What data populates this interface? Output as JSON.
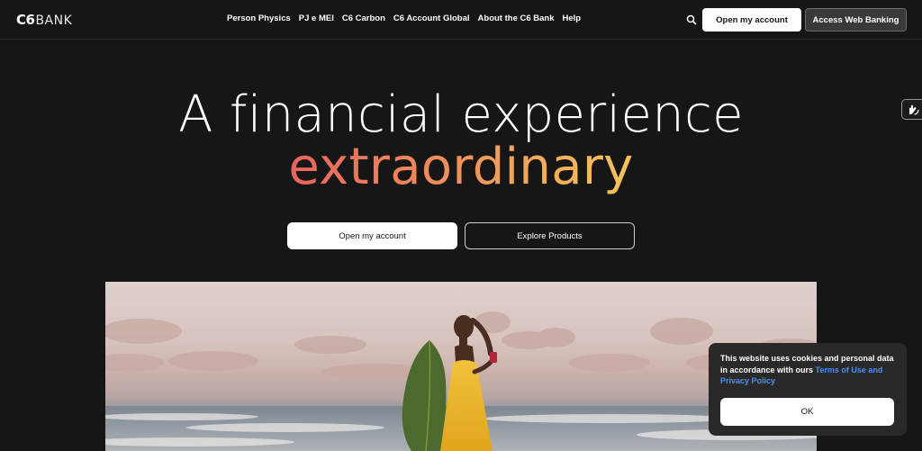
{
  "header": {
    "logo_main": "C6",
    "logo_sub": "BANK",
    "nav": [
      {
        "label": "Person Physics"
      },
      {
        "label": "PJ e MEI"
      },
      {
        "label": "C6 Carbon"
      },
      {
        "label": "C6 Account Global"
      },
      {
        "label": "About the C6 Bank"
      },
      {
        "label": "Help"
      }
    ],
    "search_icon": "search-icon",
    "open_account_label": "Open my account",
    "web_banking_label": "Access Web Banking"
  },
  "hero": {
    "line1": "A financial experience",
    "line2": "extraordinary",
    "open_account_label": "Open my account",
    "explore_label": "Explore Products"
  },
  "accessibility": {
    "icon": "sign-language-hands-icon"
  },
  "cookie": {
    "text_before": "This website uses cookies and personal data in accordance with ours ",
    "link_text": "Terms of Use and Privacy Policy",
    "ok_label": "OK"
  },
  "colors": {
    "background": "#171616",
    "gradient_start": "#e8635e",
    "gradient_end": "#f4c45a",
    "link": "#4b8ff5"
  }
}
